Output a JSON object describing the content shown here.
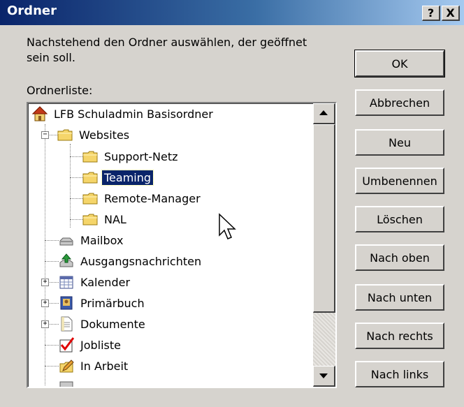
{
  "window": {
    "title": "Ordner",
    "help_label": "?",
    "close_label": "X"
  },
  "instruction": "Nachstehend den Ordner auswählen, der geöffnet sein soll.",
  "list_label": "Ordnerliste:",
  "tree": {
    "root": "LFB Schuladmin Basisordner",
    "websites": "Websites",
    "support": "Support-Netz",
    "teaming": "Teaming",
    "remote": "Remote-Manager",
    "nal": "NAL",
    "mailbox": "Mailbox",
    "ausgang": "Ausgangsnachrichten",
    "kalender": "Kalender",
    "primaer": "Primärbuch",
    "dokumente": "Dokumente",
    "jobliste": "Jobliste",
    "inarbeit": "In Arbeit",
    "selected": "Teaming"
  },
  "buttons": {
    "ok": "OK",
    "abbrechen": "Abbrechen",
    "neu": "Neu",
    "umbenennen": "Umbenennen",
    "loeschen": "Löschen",
    "nach_oben": "Nach oben",
    "nach_unten": "Nach unten",
    "nach_rechts": "Nach rechts",
    "nach_links": "Nach links"
  },
  "colors": {
    "titlebar": "#0a246a",
    "dialog": "#d6d3ce",
    "selection": "#0a246a",
    "folder": "#f5d56a",
    "checkmark": "#e00000"
  },
  "icons": [
    "home-icon",
    "folder-icon",
    "mailbox-icon",
    "outbox-icon",
    "calendar-icon",
    "address-book-icon",
    "document-icon",
    "checklist-icon",
    "pencil-icon",
    "mouse-pointer-icon"
  ]
}
